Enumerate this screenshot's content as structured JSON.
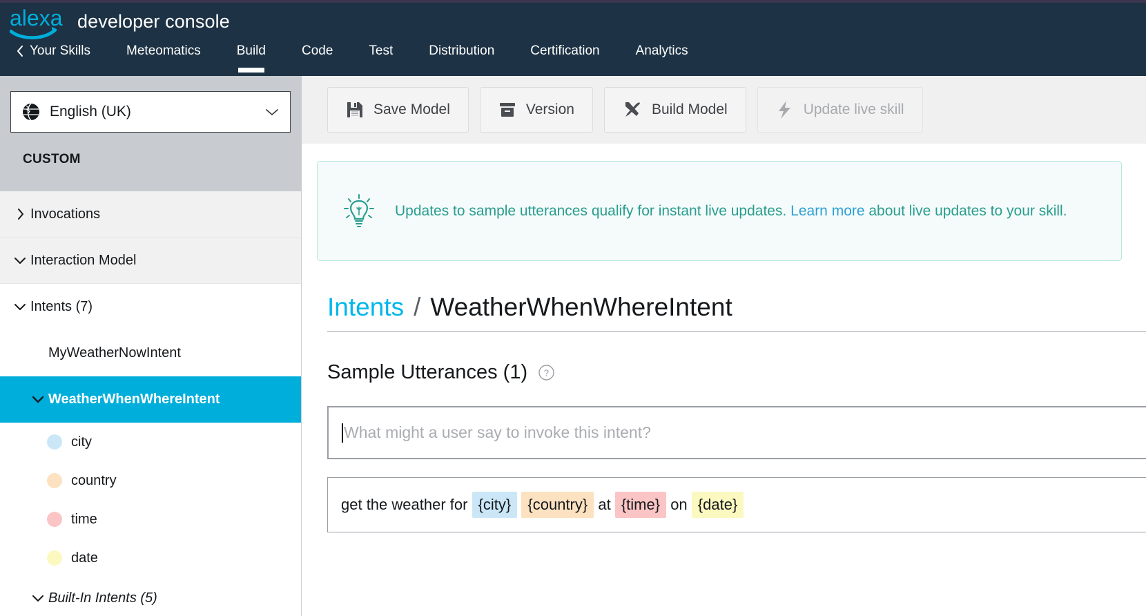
{
  "header": {
    "logo_alt": "alexa",
    "title": "developer console",
    "nav": [
      {
        "label": "Your Skills",
        "icon": "chevron-left-icon",
        "active": false
      },
      {
        "label": "Meteomatics",
        "active": false
      },
      {
        "label": "Build",
        "active": true
      },
      {
        "label": "Code",
        "active": false
      },
      {
        "label": "Test",
        "active": false
      },
      {
        "label": "Distribution",
        "active": false
      },
      {
        "label": "Certification",
        "active": false
      },
      {
        "label": "Analytics",
        "active": false
      }
    ]
  },
  "sidebar": {
    "locale": {
      "value": "English (UK)",
      "icon": "globe-icon"
    },
    "section_label": "CUSTOM",
    "tree": [
      {
        "label": "Invocations",
        "state": "collapsed"
      },
      {
        "label": "Interaction Model",
        "state": "expanded"
      },
      {
        "label": "Intents (7)",
        "state": "expanded"
      },
      {
        "label": "MyWeatherNowIntent",
        "state": "leaf"
      },
      {
        "label": "WeatherWhenWhereIntent",
        "state": "expanded-selected"
      }
    ],
    "slots": [
      {
        "name": "city",
        "color": "#cbe7f7"
      },
      {
        "name": "country",
        "color": "#fce2c0"
      },
      {
        "name": "time",
        "color": "#fbc5c5"
      },
      {
        "name": "date",
        "color": "#fbf8c0"
      }
    ],
    "builtin": {
      "label": "Built-In Intents (5)",
      "state": "expanded"
    }
  },
  "toolbar": {
    "buttons": [
      {
        "label": "Save Model",
        "icon": "floppy-disk-icon",
        "disabled": false
      },
      {
        "label": "Version",
        "icon": "archive-box-icon",
        "disabled": false
      },
      {
        "label": "Build Model",
        "icon": "hammer-wrench-icon",
        "disabled": false
      },
      {
        "label": "Update live skill",
        "icon": "lightning-bolt-icon",
        "disabled": true
      }
    ]
  },
  "banner": {
    "icon": "lightbulb-icon",
    "text_before": "Updates to sample utterances qualify for instant live updates. ",
    "link_text": "Learn more",
    "text_after": " about live updates to your skill."
  },
  "breadcrumb": {
    "parent": "Intents",
    "separator": "/",
    "current": "WeatherWhenWhereIntent"
  },
  "section": {
    "title": "Sample Utterances (1)",
    "help_icon": "question-mark-icon"
  },
  "utterance_input": {
    "placeholder": "What might a user say to invoke this intent?",
    "value": ""
  },
  "utterance_row": {
    "tokens": [
      {
        "type": "text",
        "text": "get the weather for "
      },
      {
        "type": "slot",
        "text": "{city}",
        "color": "#cbe7f7"
      },
      {
        "type": "text",
        "text": " "
      },
      {
        "type": "slot",
        "text": "{country}",
        "color": "#fce2c0"
      },
      {
        "type": "text",
        "text": " at "
      },
      {
        "type": "slot",
        "text": "{time}",
        "color": "#fbc5c5"
      },
      {
        "type": "text",
        "text": " on "
      },
      {
        "type": "slot",
        "text": "{date}",
        "color": "#fbf8c0"
      }
    ]
  },
  "colors": {
    "topbar": "#1d3244",
    "accent_blue": "#00aedb",
    "link_blue": "#00b7ea",
    "banner_teal": "#2a9d8f"
  }
}
